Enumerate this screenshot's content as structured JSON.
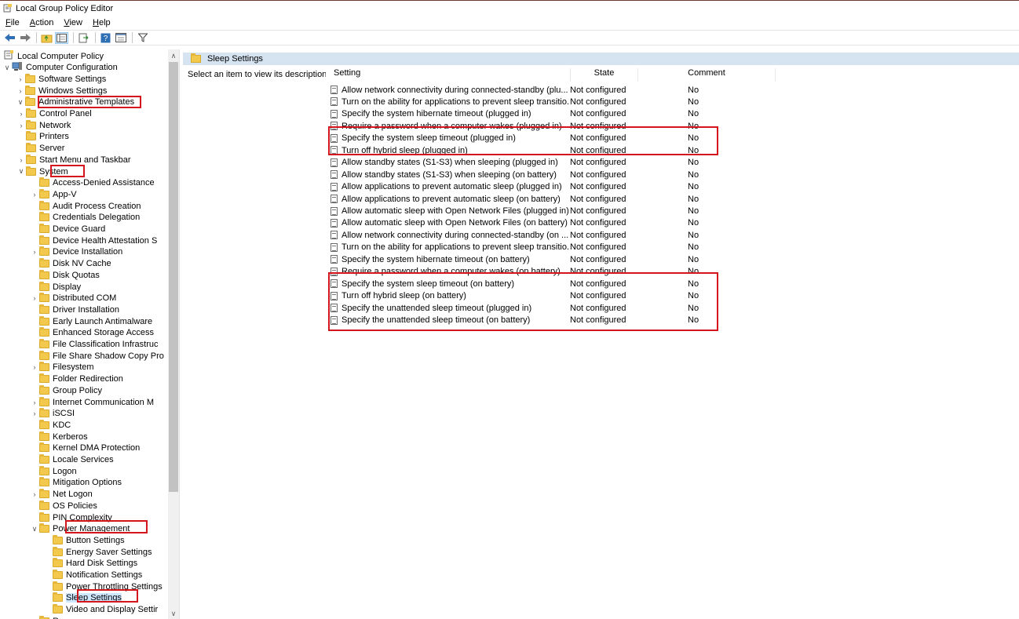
{
  "window": {
    "title": "Local Group Policy Editor"
  },
  "menu": [
    {
      "label": "File",
      "ul": "F",
      "rest": "ile"
    },
    {
      "label": "Action",
      "ul": "A",
      "rest": "ction"
    },
    {
      "label": "View",
      "ul": "V",
      "rest": "iew"
    },
    {
      "label": "Help",
      "ul": "H",
      "rest": "elp"
    }
  ],
  "toolbar": {
    "back": "back-arrow-icon",
    "forward": "forward-arrow-icon",
    "up": "up-folder-icon",
    "show_hide_tree": "console-tree-icon",
    "export": "export-list-icon",
    "help": "help-icon",
    "properties": "properties-icon",
    "filter": "filter-icon"
  },
  "tree": {
    "items": [
      {
        "label": "Local Computer Policy",
        "level": 0,
        "chev": "",
        "icon": "policy"
      },
      {
        "label": "Computer Configuration",
        "level": 0,
        "chev": "v",
        "icon": "computer"
      },
      {
        "label": "Software Settings",
        "level": 1,
        "chev": ">"
      },
      {
        "label": "Windows Settings",
        "level": 1,
        "chev": ">"
      },
      {
        "label": "Administrative Templates",
        "level": 1,
        "chev": "v"
      },
      {
        "label": "Control Panel",
        "level": 2,
        "chev": ">"
      },
      {
        "label": "Network",
        "level": 2,
        "chev": ">"
      },
      {
        "label": "Printers",
        "level": 2,
        "chev": ""
      },
      {
        "label": "Server",
        "level": 2,
        "chev": ""
      },
      {
        "label": "Start Menu and Taskbar",
        "level": 2,
        "chev": ">"
      },
      {
        "label": "System",
        "level": 2,
        "chev": "v"
      },
      {
        "label": "Access-Denied Assistance",
        "level": 3,
        "chev": ""
      },
      {
        "label": "App-V",
        "level": 3,
        "chev": ">"
      },
      {
        "label": "Audit Process Creation",
        "level": 3,
        "chev": ""
      },
      {
        "label": "Credentials Delegation",
        "level": 3,
        "chev": ""
      },
      {
        "label": "Device Guard",
        "level": 3,
        "chev": ""
      },
      {
        "label": "Device Health Attestation S",
        "level": 3,
        "chev": ""
      },
      {
        "label": "Device Installation",
        "level": 3,
        "chev": ">"
      },
      {
        "label": "Disk NV Cache",
        "level": 3,
        "chev": ""
      },
      {
        "label": "Disk Quotas",
        "level": 3,
        "chev": ""
      },
      {
        "label": "Display",
        "level": 3,
        "chev": ""
      },
      {
        "label": "Distributed COM",
        "level": 3,
        "chev": ">"
      },
      {
        "label": "Driver Installation",
        "level": 3,
        "chev": ""
      },
      {
        "label": "Early Launch Antimalware",
        "level": 3,
        "chev": ""
      },
      {
        "label": "Enhanced Storage Access",
        "level": 3,
        "chev": ""
      },
      {
        "label": "File Classification Infrastruc",
        "level": 3,
        "chev": ""
      },
      {
        "label": "File Share Shadow Copy Pro",
        "level": 3,
        "chev": ""
      },
      {
        "label": "Filesystem",
        "level": 3,
        "chev": ">"
      },
      {
        "label": "Folder Redirection",
        "level": 3,
        "chev": ""
      },
      {
        "label": "Group Policy",
        "level": 3,
        "chev": ""
      },
      {
        "label": "Internet Communication M",
        "level": 3,
        "chev": ">"
      },
      {
        "label": "iSCSI",
        "level": 3,
        "chev": ">"
      },
      {
        "label": "KDC",
        "level": 3,
        "chev": ""
      },
      {
        "label": "Kerberos",
        "level": 3,
        "chev": ""
      },
      {
        "label": "Kernel DMA Protection",
        "level": 3,
        "chev": ""
      },
      {
        "label": "Locale Services",
        "level": 3,
        "chev": ""
      },
      {
        "label": "Logon",
        "level": 3,
        "chev": ""
      },
      {
        "label": "Mitigation Options",
        "level": 3,
        "chev": ""
      },
      {
        "label": "Net Logon",
        "level": 3,
        "chev": ">"
      },
      {
        "label": "OS Policies",
        "level": 3,
        "chev": ""
      },
      {
        "label": "PIN Complexity",
        "level": 3,
        "chev": ""
      },
      {
        "label": "Power Management",
        "level": 3,
        "chev": "v"
      },
      {
        "label": "Button Settings",
        "level": 4,
        "chev": ""
      },
      {
        "label": "Energy Saver Settings",
        "level": 4,
        "chev": ""
      },
      {
        "label": "Hard Disk Settings",
        "level": 4,
        "chev": ""
      },
      {
        "label": "Notification Settings",
        "level": 4,
        "chev": ""
      },
      {
        "label": "Power Throttling Settings",
        "level": 4,
        "chev": ""
      },
      {
        "label": "Sleep Settings",
        "level": 4,
        "chev": "",
        "selected": true
      },
      {
        "label": "Video and Display Settir",
        "level": 4,
        "chev": ""
      },
      {
        "label": "Recovery",
        "level": 3,
        "chev": ""
      }
    ]
  },
  "right_pane": {
    "header": "Sleep Settings",
    "description": "Select an item to view its description."
  },
  "list": {
    "columns": {
      "setting": "Setting",
      "state": "State",
      "comment": "Comment"
    },
    "rows": [
      {
        "setting": "Allow network connectivity during connected-standby (plu...",
        "state": "Not configured",
        "comment": "No"
      },
      {
        "setting": "Turn on the ability for applications to prevent sleep transitio...",
        "state": "Not configured",
        "comment": "No"
      },
      {
        "setting": "Specify the system hibernate timeout (plugged in)",
        "state": "Not configured",
        "comment": "No"
      },
      {
        "setting": "Require a password when a computer wakes (plugged in)",
        "state": "Not configured",
        "comment": "No"
      },
      {
        "setting": "Specify the system sleep timeout (plugged in)",
        "state": "Not configured",
        "comment": "No"
      },
      {
        "setting": "Turn off hybrid sleep (plugged in)",
        "state": "Not configured",
        "comment": "No"
      },
      {
        "setting": "Allow standby states (S1-S3) when sleeping (plugged in)",
        "state": "Not configured",
        "comment": "No"
      },
      {
        "setting": "Allow standby states (S1-S3) when sleeping (on battery)",
        "state": "Not configured",
        "comment": "No"
      },
      {
        "setting": "Allow applications to prevent automatic sleep (plugged in)",
        "state": "Not configured",
        "comment": "No"
      },
      {
        "setting": "Allow applications to prevent automatic sleep (on battery)",
        "state": "Not configured",
        "comment": "No"
      },
      {
        "setting": "Allow automatic sleep with Open Network Files (plugged in)",
        "state": "Not configured",
        "comment": "No"
      },
      {
        "setting": "Allow automatic sleep with Open Network Files (on battery)",
        "state": "Not configured",
        "comment": "No"
      },
      {
        "setting": "Allow network connectivity during connected-standby (on ...",
        "state": "Not configured",
        "comment": "No"
      },
      {
        "setting": "Turn on the ability for applications to prevent sleep transitio...",
        "state": "Not configured",
        "comment": "No"
      },
      {
        "setting": "Specify the system hibernate timeout (on battery)",
        "state": "Not configured",
        "comment": "No"
      },
      {
        "setting": "Require a password when a computer wakes (on battery)",
        "state": "Not configured",
        "comment": "No"
      },
      {
        "setting": "Specify the system sleep timeout (on battery)",
        "state": "Not configured",
        "comment": "No"
      },
      {
        "setting": "Turn off hybrid sleep (on battery)",
        "state": "Not configured",
        "comment": "No"
      },
      {
        "setting": "Specify the unattended sleep timeout (plugged in)",
        "state": "Not configured",
        "comment": "No"
      },
      {
        "setting": "Specify the unattended sleep timeout (on battery)",
        "state": "Not configured",
        "comment": "No"
      }
    ]
  },
  "colors": {
    "highlight": "#d4151b",
    "header_band": "#d6e3f1",
    "folder": "#f2c94c",
    "selection": "#cde8ff"
  }
}
